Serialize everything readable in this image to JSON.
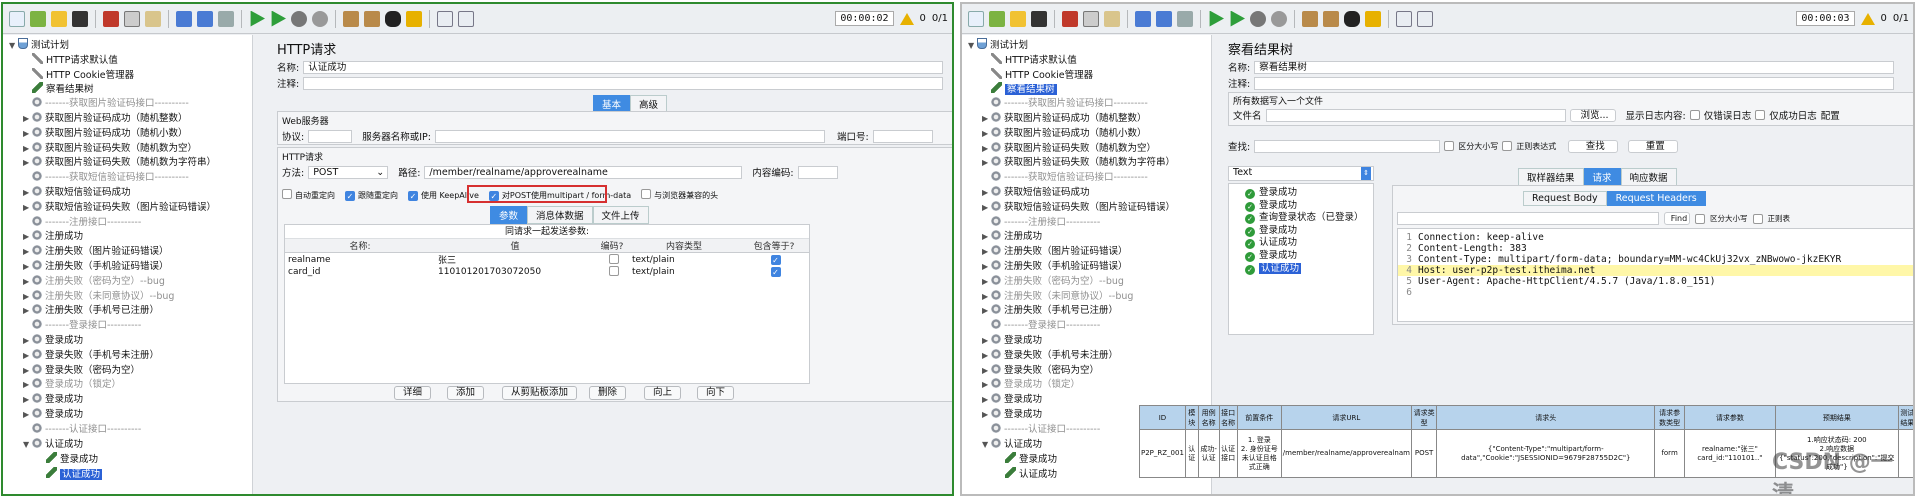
{
  "left": {
    "toolbar": {
      "timer": "00:00:02",
      "warn_count": "0",
      "ratio": "0/1"
    },
    "tree": {
      "items": [
        {
          "label": "测试计划",
          "indent": 0,
          "icon": "flask",
          "tw": "▼"
        },
        {
          "label": "HTTP请求默认值",
          "indent": 1,
          "icon": "wrench"
        },
        {
          "label": "HTTP Cookie管理器",
          "indent": 1,
          "icon": "wrench"
        },
        {
          "label": "察看结果树",
          "indent": 1,
          "icon": "pencil"
        },
        {
          "label": "-------获取图片验证码接口----------",
          "indent": 1,
          "icon": "gear",
          "grey": true
        },
        {
          "label": "获取图片验证码成功（随机整数）",
          "indent": 1,
          "icon": "gear",
          "tw": "▶"
        },
        {
          "label": "获取图片验证码成功（随机小数）",
          "indent": 1,
          "icon": "gear",
          "tw": "▶"
        },
        {
          "label": "获取图片验证码失败（随机数为空）",
          "indent": 1,
          "icon": "gear",
          "tw": "▶"
        },
        {
          "label": "获取图片验证码失败（随机数为字符串）",
          "indent": 1,
          "icon": "gear",
          "tw": "▶"
        },
        {
          "label": "-------获取短信验证码接口----------",
          "indent": 1,
          "icon": "gear",
          "grey": true
        },
        {
          "label": "获取短信验证码成功",
          "indent": 1,
          "icon": "gear",
          "tw": "▶"
        },
        {
          "label": "获取短信验证码失败（图片验证码错误）",
          "indent": 1,
          "icon": "gear",
          "tw": "▶"
        },
        {
          "label": "-------注册接口----------",
          "indent": 1,
          "icon": "gear",
          "grey": true
        },
        {
          "label": "注册成功",
          "indent": 1,
          "icon": "gear",
          "tw": "▶"
        },
        {
          "label": "注册失败（图片验证码错误）",
          "indent": 1,
          "icon": "gear",
          "tw": "▶"
        },
        {
          "label": "注册失败（手机验证码错误）",
          "indent": 1,
          "icon": "gear",
          "tw": "▶"
        },
        {
          "label": "注册失败（密码为空）--bug",
          "indent": 1,
          "icon": "gear",
          "tw": "▶",
          "grey": true
        },
        {
          "label": "注册失败（未同意协议）--bug",
          "indent": 1,
          "icon": "gear",
          "tw": "▶",
          "grey": true
        },
        {
          "label": "注册失败（手机号已注册）",
          "indent": 1,
          "icon": "gear",
          "tw": "▶"
        },
        {
          "label": "-------登录接口----------",
          "indent": 1,
          "icon": "gear",
          "grey": true
        },
        {
          "label": "登录成功",
          "indent": 1,
          "icon": "gear",
          "tw": "▶"
        },
        {
          "label": "登录失败（手机号未注册）",
          "indent": 1,
          "icon": "gear",
          "tw": "▶"
        },
        {
          "label": "登录失败（密码为空）",
          "indent": 1,
          "icon": "gear",
          "tw": "▶"
        },
        {
          "label": "登录成功（锁定）",
          "indent": 1,
          "icon": "gear",
          "tw": "▶",
          "grey": true
        },
        {
          "label": "登录成功",
          "indent": 1,
          "icon": "gear",
          "tw": "▶"
        },
        {
          "label": "登录成功",
          "indent": 1,
          "icon": "gear",
          "tw": "▶"
        },
        {
          "label": "-------认证接口----------",
          "indent": 1,
          "icon": "gear",
          "grey": true
        },
        {
          "label": "认证成功",
          "indent": 1,
          "icon": "gear",
          "tw": "▼"
        },
        {
          "label": "登录成功",
          "indent": 2,
          "icon": "pencil"
        },
        {
          "label": "认证成功",
          "indent": 2,
          "icon": "pencil",
          "selected": true
        }
      ]
    },
    "main": {
      "title": "HTTP请求",
      "name_label": "名称:",
      "name_value": "认证成功",
      "comment_label": "注释:",
      "tabs": [
        "基本",
        "高级"
      ],
      "server_section": "Web服务器",
      "protocol_label": "协议:",
      "server_label": "服务器名称或IP:",
      "port_label": "端口号:",
      "http_section": "HTTP请求",
      "method_label": "方法:",
      "method_value": "POST",
      "path_label": "路径:",
      "path_value": "/member/realname/approverealname",
      "encoding_label": "内容编码:",
      "options": [
        {
          "label": "自动重定向",
          "checked": false
        },
        {
          "label": "跟随重定向",
          "checked": true
        },
        {
          "label": "使用 KeepAlive",
          "checked": true
        },
        {
          "label": "对POST使用multipart / form-data",
          "checked": true
        },
        {
          "label": "与浏览器兼容的头",
          "checked": false
        }
      ],
      "subtabs": [
        "参数",
        "消息体数据",
        "文件上传"
      ],
      "params_title": "同请求一起发送参数:",
      "param_headers": [
        "名称:",
        "值",
        "编码?",
        "内容类型",
        "包含等于?"
      ],
      "params": [
        {
          "name": "realname",
          "value": "张三",
          "encode": false,
          "type": "text/plain",
          "equals": true
        },
        {
          "name": "card_id",
          "value": "110101201703072050",
          "encode": false,
          "type": "text/plain",
          "equals": true
        }
      ],
      "buttons": [
        "详细",
        "添加",
        "从剪贴板添加",
        "删除",
        "向上",
        "向下"
      ]
    }
  },
  "right": {
    "toolbar": {
      "timer": "00:00:03",
      "warn_count": "0",
      "ratio": "0/1"
    },
    "tree": {
      "items": [
        {
          "label": "测试计划",
          "indent": 0,
          "icon": "flask",
          "tw": "▼"
        },
        {
          "label": "HTTP请求默认值",
          "indent": 1,
          "icon": "wrench"
        },
        {
          "label": "HTTP Cookie管理器",
          "indent": 1,
          "icon": "wrench"
        },
        {
          "label": "察看结果树",
          "indent": 1,
          "icon": "pencil",
          "selected": true
        },
        {
          "label": "-------获取图片验证码接口----------",
          "indent": 1,
          "icon": "gear",
          "grey": true
        },
        {
          "label": "获取图片验证码成功（随机整数）",
          "indent": 1,
          "icon": "gear",
          "tw": "▶"
        },
        {
          "label": "获取图片验证码成功（随机小数）",
          "indent": 1,
          "icon": "gear",
          "tw": "▶"
        },
        {
          "label": "获取图片验证码失败（随机数为空）",
          "indent": 1,
          "icon": "gear",
          "tw": "▶"
        },
        {
          "label": "获取图片验证码失败（随机数为字符串）",
          "indent": 1,
          "icon": "gear",
          "tw": "▶"
        },
        {
          "label": "-------获取短信验证码接口----------",
          "indent": 1,
          "icon": "gear",
          "grey": true
        },
        {
          "label": "获取短信验证码成功",
          "indent": 1,
          "icon": "gear",
          "tw": "▶"
        },
        {
          "label": "获取短信验证码失败（图片验证码错误）",
          "indent": 1,
          "icon": "gear",
          "tw": "▶"
        },
        {
          "label": "-------注册接口----------",
          "indent": 1,
          "icon": "gear",
          "grey": true
        },
        {
          "label": "注册成功",
          "indent": 1,
          "icon": "gear",
          "tw": "▶"
        },
        {
          "label": "注册失败（图片验证码错误）",
          "indent": 1,
          "icon": "gear",
          "tw": "▶"
        },
        {
          "label": "注册失败（手机验证码错误）",
          "indent": 1,
          "icon": "gear",
          "tw": "▶"
        },
        {
          "label": "注册失败（密码为空）--bug",
          "indent": 1,
          "icon": "gear",
          "tw": "▶",
          "grey": true
        },
        {
          "label": "注册失败（未同意协议）--bug",
          "indent": 1,
          "icon": "gear",
          "tw": "▶",
          "grey": true
        },
        {
          "label": "注册失败（手机号已注册）",
          "indent": 1,
          "icon": "gear",
          "tw": "▶"
        },
        {
          "label": "-------登录接口----------",
          "indent": 1,
          "icon": "gear",
          "grey": true
        },
        {
          "label": "登录成功",
          "indent": 1,
          "icon": "gear",
          "tw": "▶"
        },
        {
          "label": "登录失败（手机号未注册）",
          "indent": 1,
          "icon": "gear",
          "tw": "▶"
        },
        {
          "label": "登录失败（密码为空）",
          "indent": 1,
          "icon": "gear",
          "tw": "▶"
        },
        {
          "label": "登录成功（锁定）",
          "indent": 1,
          "icon": "gear",
          "tw": "▶",
          "grey": true
        },
        {
          "label": "登录成功",
          "indent": 1,
          "icon": "gear",
          "tw": "▶"
        },
        {
          "label": "登录成功",
          "indent": 1,
          "icon": "gear",
          "tw": "▶"
        },
        {
          "label": "-------认证接口----------",
          "indent": 1,
          "icon": "gear",
          "grey": true
        },
        {
          "label": "认证成功",
          "indent": 1,
          "icon": "gear",
          "tw": "▼"
        },
        {
          "label": "登录成功",
          "indent": 2,
          "icon": "pencil"
        },
        {
          "label": "认证成功",
          "indent": 2,
          "icon": "pencil"
        }
      ]
    },
    "main": {
      "title": "察看结果树",
      "name_label": "名称:",
      "name_value": "察看结果树",
      "comment_label": "注释:",
      "write_all": "所有数据写入一个文件",
      "filename_label": "文件名",
      "browse": "浏览...",
      "show_log": "显示日志内容:",
      "only_errors": "仅错误日志",
      "only_success": "仅成功日志",
      "config": "配置",
      "find_label": "查找:",
      "case_sensitive": "区分大小写",
      "regex": "正则表达式",
      "find_btn": "查找",
      "reset_btn": "重置",
      "renderer": "Text",
      "result_tabs": [
        "取样器结果",
        "请求",
        "响应数据"
      ],
      "results": [
        "登录成功",
        "登录成功",
        "查询登录状态（已登录）",
        "登录成功",
        "认证成功",
        "登录成功",
        "认证成功"
      ],
      "body_tabs": [
        "Request Body",
        "Request Headers"
      ],
      "find_small": "Find",
      "case_small": "区分大小写",
      "regex_small": "正则表",
      "headers": [
        {
          "n": "1",
          "text": "Connection: keep-alive"
        },
        {
          "n": "2",
          "text": "Content-Length: 383"
        },
        {
          "n": "3",
          "text": "Content-Type: multipart/form-data; boundary=MM-wc4CkUj32vx_zNBwowo-jkzEKYR"
        },
        {
          "n": "4",
          "text": "Host: user-p2p-test.itheima.net"
        },
        {
          "n": "5",
          "text": "User-Agent: Apache-HttpClient/4.5.7 (Java/1.8.0_151)"
        },
        {
          "n": "6",
          "text": ""
        }
      ]
    },
    "doc_table": {
      "headers": [
        "ID",
        "模块",
        "用例名称",
        "接口名称",
        "前置条件",
        "请求URL",
        "请求类型",
        "请求头",
        "请求参数类型",
        "请求参数",
        "预期结果",
        "测试结果"
      ],
      "row": [
        "P2P_RZ_001",
        "认证",
        "成功-认证",
        "认证接口",
        "1. 登录\n2. 身份证号未认证且格式正确",
        "/member/realname/approverealnam",
        "POST",
        "{\"Content-Type\":\"multipart/form-data\",\"Cookie\":\"JSESSIONID=9679F28755D2C\"}",
        "form",
        "realname:\"张三\" card_id:\"110101..\"",
        "1.响应状态码: 200\n2.响应数据\n{\"status\":200,\"description\":\"提交成功\"}",
        ""
      ]
    },
    "watermark": "CSDN @一清"
  }
}
